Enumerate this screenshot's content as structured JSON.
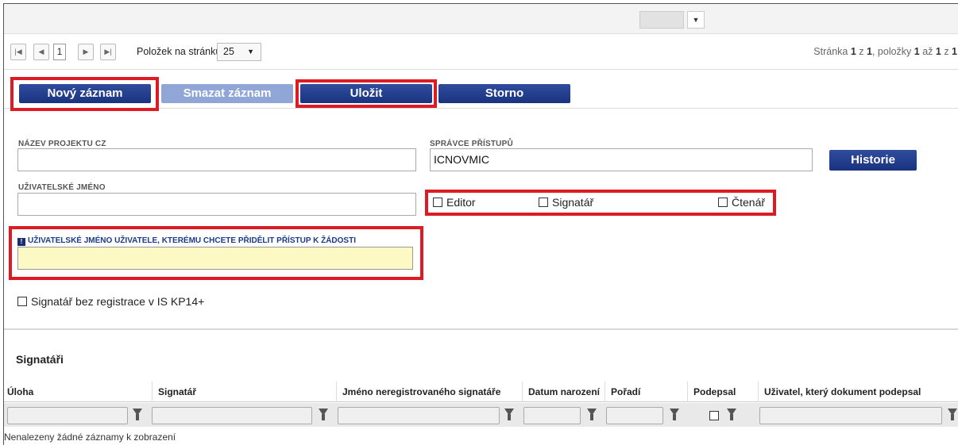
{
  "pager": {
    "first": "⏮",
    "prev": "◀",
    "page": "1",
    "next": "▶",
    "last": "⏭",
    "per_page_label": "Položek na stránku",
    "per_page_value": "25",
    "info_prefix": "Stránka ",
    "info_page": "1",
    "info_mid": " z ",
    "info_pages": "1",
    "info_items": ", položky ",
    "info_from": "1",
    "info_to_label": " až ",
    "info_to": "1",
    "info_of": " z ",
    "info_total": "1"
  },
  "toolbar": {
    "new_label": "Nový záznam",
    "delete_label": "Smazat záznam",
    "save_label": "Uložit",
    "cancel_label": "Storno"
  },
  "form": {
    "project_name_label": "NÁZEV PROJEKTU CZ",
    "project_name_value": "",
    "access_admin_label": "SPRÁVCE PŘÍSTUPŮ",
    "access_admin_value": "ICNOVMIC",
    "history_label": "Historie",
    "username_label": "UŽIVATELSKÉ JMÉNO",
    "username_value": "",
    "role_editor": "Editor",
    "role_signatory": "Signatář",
    "role_reader": "Čtenář",
    "target_user_label": "UŽIVATELSKÉ JMÉNO UŽIVATELE, KTERÉMU CHCETE PŘIDĚLIT PŘÍSTUP K ŽÁDOSTI",
    "target_user_value": "",
    "unregistered_label": "Signatář bez registrace v IS KP14+"
  },
  "signatories": {
    "title": "Signatáři",
    "columns": [
      "Úloha",
      "Signatář",
      "Jméno neregistrovaného signatáře",
      "Datum narození",
      "Pořadí",
      "Podepsal",
      "Uživatel, který dokument podepsal"
    ],
    "empty_text": "Nenalezeny žádné záznamy k zobrazení"
  },
  "colors": {
    "accent": "#1a3380",
    "highlight": "#dd1b24",
    "required_bg": "#fdf9c4"
  }
}
